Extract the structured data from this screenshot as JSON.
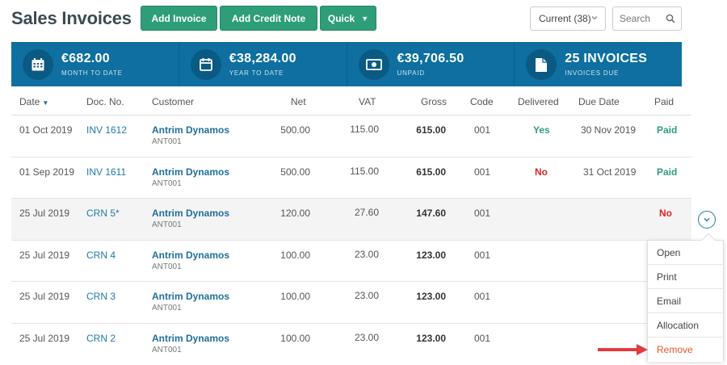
{
  "header": {
    "title": "Sales Invoices",
    "add_invoice_label": "Add Invoice",
    "add_credit_note_label": "Add Credit Note",
    "quick_label": "Quick",
    "filter_label": "Current (38)",
    "search_placeholder": "Search"
  },
  "stats": [
    {
      "value": "€682.00",
      "label": "MONTH TO DATE",
      "icon": "calendar-grid-icon"
    },
    {
      "value": "€38,284.00",
      "label": "YEAR TO DATE",
      "icon": "calendar-icon"
    },
    {
      "value": "€39,706.50",
      "label": "UNPAID",
      "icon": "cash-icon"
    },
    {
      "value": "25 INVOICES",
      "label": "INVOICES DUE",
      "icon": "document-icon"
    }
  ],
  "table": {
    "columns": [
      "Date",
      "Doc. No.",
      "Customer",
      "Net",
      "VAT",
      "Gross",
      "Code",
      "Delivered",
      "Due Date",
      "Paid"
    ],
    "rows": [
      {
        "date": "01 Oct 2019",
        "doc": "INV 1612",
        "customer": "Antrim Dynamos",
        "cust_code": "ANT001",
        "net": "500.00",
        "vat": "115.00",
        "gross": "615.00",
        "code": "001",
        "delivered": "Yes",
        "due": "30 Nov 2019",
        "paid": "Paid"
      },
      {
        "date": "01 Sep 2019",
        "doc": "INV 1611",
        "customer": "Antrim Dynamos",
        "cust_code": "ANT001",
        "net": "500.00",
        "vat": "115.00",
        "gross": "615.00",
        "code": "001",
        "delivered": "No",
        "due": "31 Oct 2019",
        "paid": "Paid"
      },
      {
        "date": "25 Jul 2019",
        "doc": "CRN 5*",
        "customer": "Antrim Dynamos",
        "cust_code": "ANT001",
        "net": "120.00",
        "vat": "27.60",
        "gross": "147.60",
        "code": "001",
        "delivered": "",
        "due": "",
        "paid": "No"
      },
      {
        "date": "25 Jul 2019",
        "doc": "CRN 4",
        "customer": "Antrim Dynamos",
        "cust_code": "ANT001",
        "net": "100.00",
        "vat": "23.00",
        "gross": "123.00",
        "code": "001",
        "delivered": "",
        "due": "",
        "paid": ""
      },
      {
        "date": "25 Jul 2019",
        "doc": "CRN 3",
        "customer": "Antrim Dynamos",
        "cust_code": "ANT001",
        "net": "100.00",
        "vat": "23.00",
        "gross": "123.00",
        "code": "001",
        "delivered": "",
        "due": "",
        "paid": ""
      },
      {
        "date": "25 Jul 2019",
        "doc": "CRN 2",
        "customer": "Antrim Dynamos",
        "cust_code": "ANT001",
        "net": "100.00",
        "vat": "23.00",
        "gross": "123.00",
        "code": "001",
        "delivered": "",
        "due": "",
        "paid": ""
      }
    ]
  },
  "row_menu": {
    "items": [
      "Open",
      "Print",
      "Email",
      "Allocation",
      "Remove"
    ]
  },
  "colors": {
    "brand_green": "#2e9e79",
    "stats_blue": "#0e6fa0",
    "danger_red": "#d62828",
    "remove_orange": "#e4572e"
  }
}
